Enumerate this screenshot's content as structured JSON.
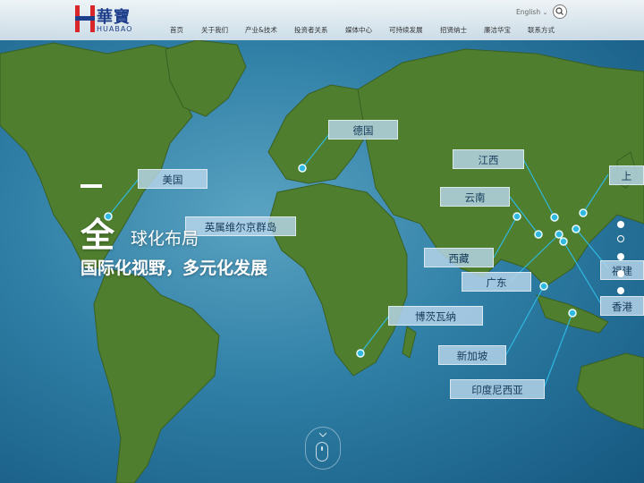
{
  "brand": {
    "name_cn": "華寶",
    "name_en": "HUABAO",
    "accent": "#d9262b",
    "primary": "#1d3e8a"
  },
  "nav": {
    "items": [
      {
        "label": "首页"
      },
      {
        "label": "关于我们"
      },
      {
        "label": "产业&技术"
      },
      {
        "label": "投资者关系"
      },
      {
        "label": "媒体中心"
      },
      {
        "label": "可持续发展"
      },
      {
        "label": "招贤纳士"
      },
      {
        "label": "廉洁华宝"
      },
      {
        "label": "联系方式"
      }
    ],
    "language": "English",
    "language_icon": "chevron-down-icon",
    "search_icon": "search-icon"
  },
  "hero": {
    "dash": "—",
    "big_char": "全",
    "title_rest": "球化布局",
    "subtitle": "国际化视野，多元化发展"
  },
  "map_labels": [
    {
      "text": "德国"
    },
    {
      "text": "美国"
    },
    {
      "text": "江西"
    },
    {
      "text": "云南"
    },
    {
      "text": "西藏"
    },
    {
      "text": "广东"
    },
    {
      "text": "英属维尔京群岛"
    },
    {
      "text": "博茨瓦纳"
    },
    {
      "text": "新加坡"
    },
    {
      "text": "印度尼西亚"
    },
    {
      "text": "上"
    },
    {
      "text": "福建"
    },
    {
      "text": "香港"
    }
  ],
  "slider": {
    "count": 5,
    "active_index": 0
  },
  "scroll_hint_icon": "mouse-icon",
  "colors": {
    "ocean": "#2f7fa6",
    "land": "#4f7f2e",
    "marker": "#2fb8e0",
    "label_bg": "#b9d7eb"
  }
}
